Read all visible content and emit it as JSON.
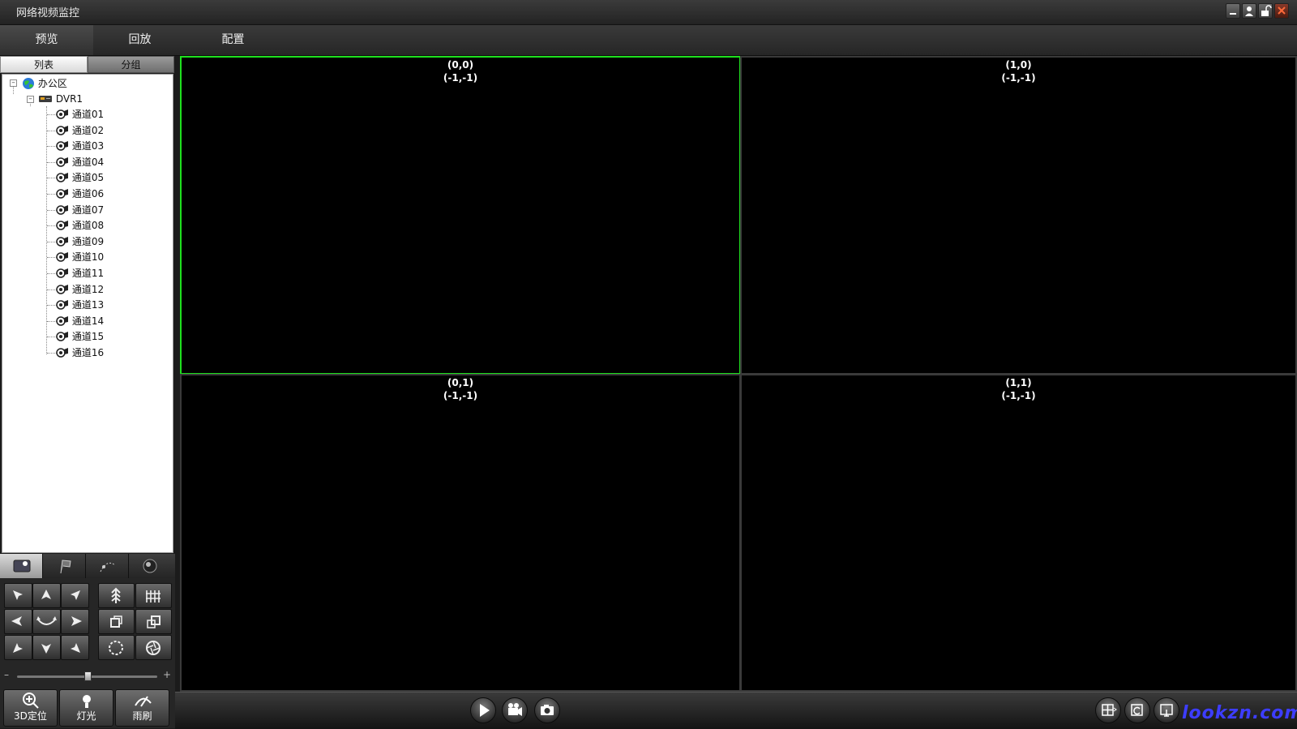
{
  "app": {
    "title": "网络视频监控"
  },
  "menu": {
    "items": [
      "预览",
      "回放",
      "配置"
    ],
    "active_index": 0
  },
  "left_tabs": {
    "list": "列表",
    "group": "分组"
  },
  "tree": {
    "root": "办公区",
    "device": "DVR1",
    "channels": [
      "通道01",
      "通道02",
      "通道03",
      "通道04",
      "通道05",
      "通道06",
      "通道07",
      "通道08",
      "通道09",
      "通道10",
      "通道11",
      "通道12",
      "通道13",
      "通道14",
      "通道15",
      "通道16"
    ]
  },
  "ptz": {
    "tabs": [
      "ptz-control-icon",
      "flag-preset-icon",
      "cruise-path-icon",
      "lens-ball-icon"
    ],
    "zoom_minus": "–",
    "zoom_plus": "+",
    "zoom_level": 0.5,
    "buttons": {
      "position3d": "3D定位",
      "light": "灯光",
      "wiper": "雨刷"
    }
  },
  "panes": [
    {
      "coord": "(0,0)",
      "channel": "(-1,-1)",
      "selected": true
    },
    {
      "coord": "(1,0)",
      "channel": "(-1,-1)",
      "selected": false
    },
    {
      "coord": "(0,1)",
      "channel": "(-1,-1)",
      "selected": false
    },
    {
      "coord": "(1,1)",
      "channel": "(-1,-1)",
      "selected": false
    }
  ],
  "watermark": "lookzn.com",
  "colors": {
    "selected_border": "#1ee01e",
    "watermark": "#3d3dff"
  }
}
